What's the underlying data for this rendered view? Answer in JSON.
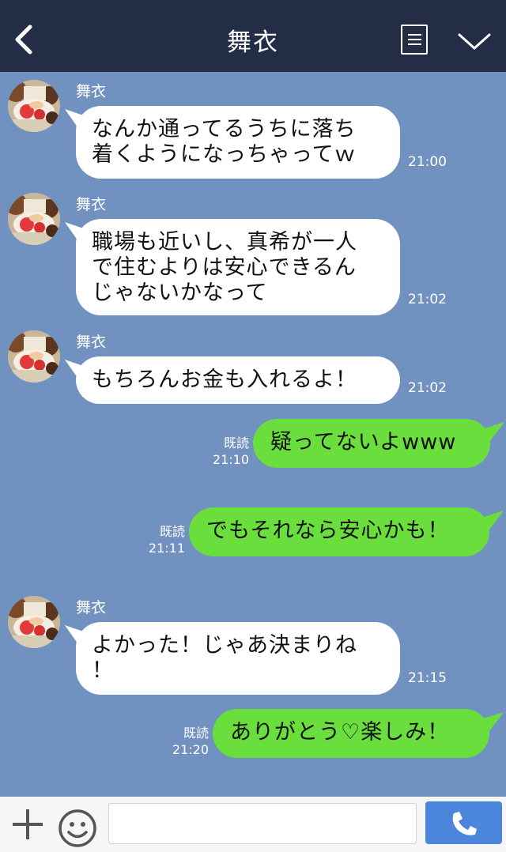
{
  "header": {
    "title": "舞衣"
  },
  "messages": [
    {
      "sender": "舞衣",
      "text": "なんか通ってるうちに落ち\n着くようになっちゃってｗ",
      "time": "21:00"
    },
    {
      "sender": "舞衣",
      "text": "職場も近いし、真希が一人\nで住むよりは安心できるん\nじゃないかなって",
      "time": "21:02"
    },
    {
      "sender": "舞衣",
      "text": "もちろんお金も入れるよ！",
      "time": "21:02"
    },
    {
      "read": "既読",
      "text": "疑ってないよwww",
      "time": "21:10"
    },
    {
      "read": "既読",
      "text": "でもそれなら安心かも！",
      "time": "21:11"
    },
    {
      "sender": "舞衣",
      "text": "よかった！じゃあ決まりね\n！",
      "time": "21:15"
    },
    {
      "read": "既読",
      "text": "ありがとう♡楽しみ！",
      "time": "21:20"
    }
  ],
  "composer": {
    "placeholder": ""
  },
  "icons": [
    "back-chevron-icon",
    "menu-document-icon",
    "chevron-down-icon",
    "plus-icon",
    "smiley-icon",
    "phone-icon"
  ],
  "colors": {
    "header": "#232e46",
    "background": "#7192c0",
    "outgoing_bubble": "#6ade3d",
    "call_button": "#4c86dc"
  }
}
